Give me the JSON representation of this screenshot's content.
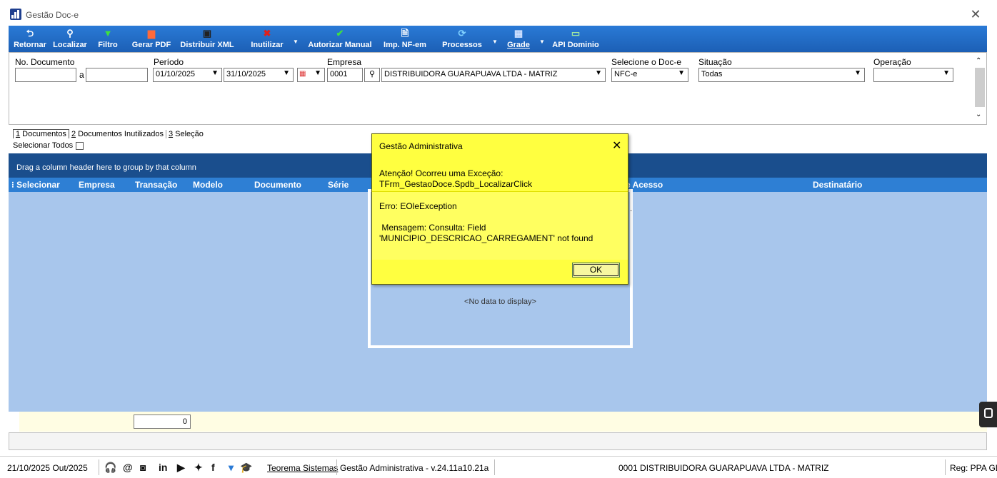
{
  "window": {
    "title": "Gestão Doc-e"
  },
  "toolbar": {
    "buttons": [
      {
        "label": "Retornar",
        "icon": "return-arrow-icon"
      },
      {
        "label": "Localizar",
        "icon": "search-icon"
      },
      {
        "label": "Filtro",
        "icon": "filter-funnel-icon"
      },
      {
        "label": "Gerar PDF",
        "icon": "pdf-icon"
      },
      {
        "label": "Distribuir XML",
        "icon": "save-disk-icon"
      },
      {
        "label": "Inutilizar",
        "icon": "red-x-icon"
      },
      {
        "label": "Autorizar Manual",
        "icon": "check-icon"
      },
      {
        "label": "Imp. NF-em",
        "icon": "document-icon"
      },
      {
        "label": "Processos",
        "icon": "cycle-icon"
      },
      {
        "label": "Grade",
        "icon": "grid-icon"
      },
      {
        "label": "API Dominio",
        "icon": "api-icon"
      }
    ]
  },
  "filters": {
    "no_documento": {
      "label": "No. Documento",
      "value_from": "",
      "sep": "a",
      "value_to": ""
    },
    "periodo": {
      "label": "Período",
      "from": "01/10/2025",
      "to": "31/10/2025"
    },
    "empresa": {
      "label": "Empresa",
      "code": "0001",
      "name": "DISTRIBUIDORA GUARAPUAVA LTDA - MATRIZ"
    },
    "doc_e": {
      "label": "Selecione o Doc-e",
      "value": "NFC-e"
    },
    "situacao": {
      "label": "Situação",
      "value": "Todas"
    },
    "operacao": {
      "label": "Operação",
      "value": ""
    }
  },
  "tabs": [
    {
      "key": "1",
      "label": " Documentos"
    },
    {
      "key": "2",
      "label": " Documentos Inutilizados"
    },
    {
      "key": "3",
      "label": " Seleção"
    }
  ],
  "grid": {
    "select_all_label": "Selecionar Todos",
    "group_hint": "Drag a column header here to group by that column",
    "columns": [
      "Selecionar",
      "Empresa",
      "Transação",
      "Modelo",
      "Documento",
      "Série",
      "e Acesso",
      "Destinatário"
    ],
    "empty_text": "<No data to display>",
    "footer_total": "0"
  },
  "statusbar": {
    "date": "21/10/2025 Out/2025",
    "company_link": "Teorema Sistemas",
    "version": "Gestão Administrativa - v.24.11a10.21a",
    "company": "0001 DISTRIBUIDORA GUARAPUAVA LTDA - MATRIZ",
    "reg": "Reg: PPA GL"
  },
  "dialog": {
    "title": "Gestão Administrativa",
    "line1": "Atenção! Ocorreu uma Exceção:",
    "line2": "TFrm_GestaoDoce.Spdb_LocalizarClick",
    "error": "Erro: EOleException",
    "msg1": " Mensagem: Consulta: Field",
    "msg2": "'MUNICIPIO_DESCRICAO_CARREGAMENT' not found",
    "ok": "OK"
  }
}
